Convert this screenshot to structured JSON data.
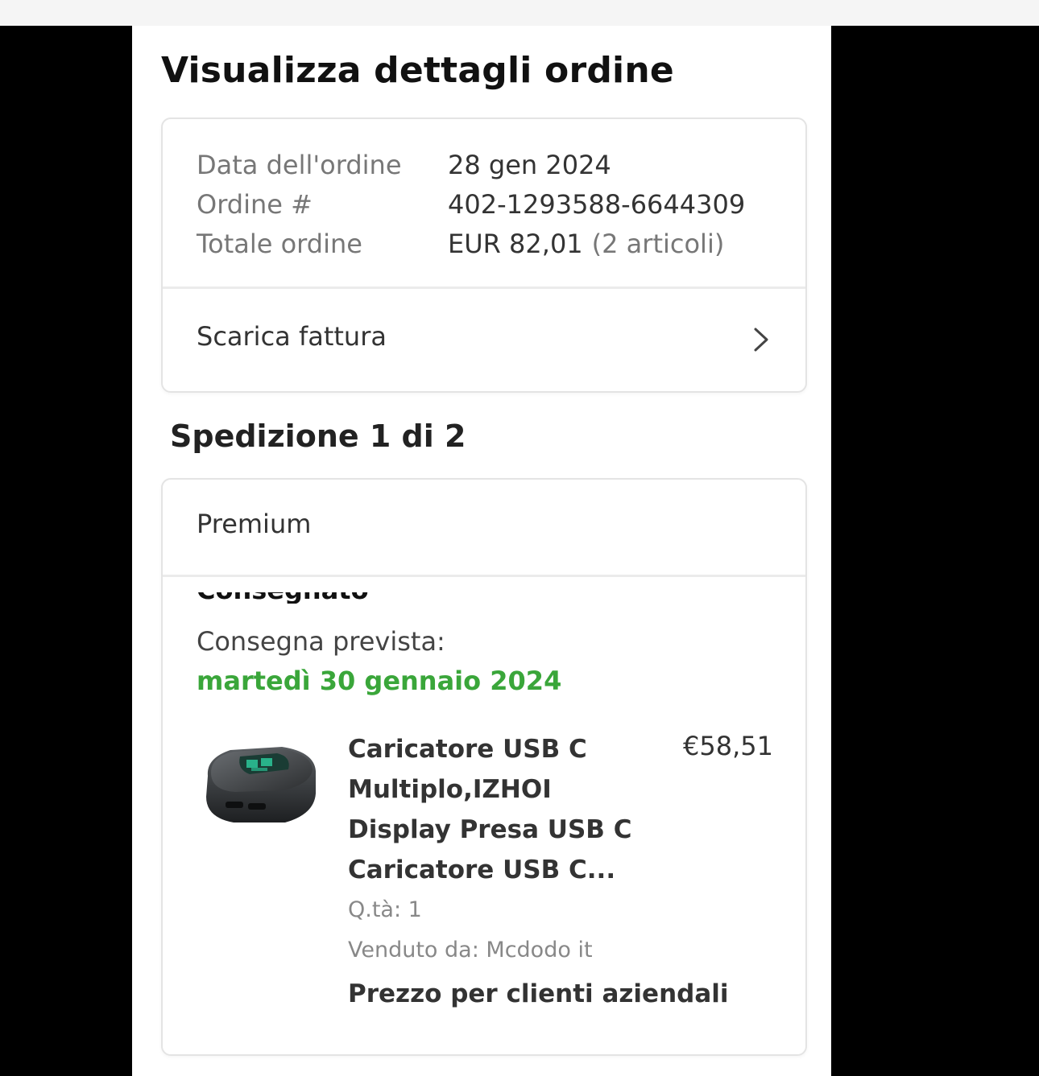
{
  "page": {
    "title": "Visualizza dettagli ordine"
  },
  "order": {
    "date_label": "Data dell'ordine",
    "date_value": "28 gen 2024",
    "number_label": "Ordine #",
    "number_value": "402-1293588-6644309",
    "total_label": "Totale ordine",
    "total_value": "EUR 82,01",
    "total_items": "(2 articoli)",
    "invoice_label": "Scarica fattura"
  },
  "shipment": {
    "title": "Spedizione 1 di 2",
    "type": "Premium",
    "cut_status": "Consegnato",
    "delivery_label": "Consegna prevista:",
    "delivery_date": "martedì 30 gennaio 2024",
    "delivery_color": "#3aa63a",
    "product": {
      "image": "usb-charger-image",
      "title_lines": [
        "Caricatore USB C",
        "Multiplo,IZHOI",
        "Display Presa USB C",
        "Caricatore USB C..."
      ],
      "price": "€58,51",
      "qty": "Q.tà: 1",
      "seller": "Venduto da: Mcdodo it",
      "business_note": "Prezzo per clienti aziendali"
    }
  }
}
